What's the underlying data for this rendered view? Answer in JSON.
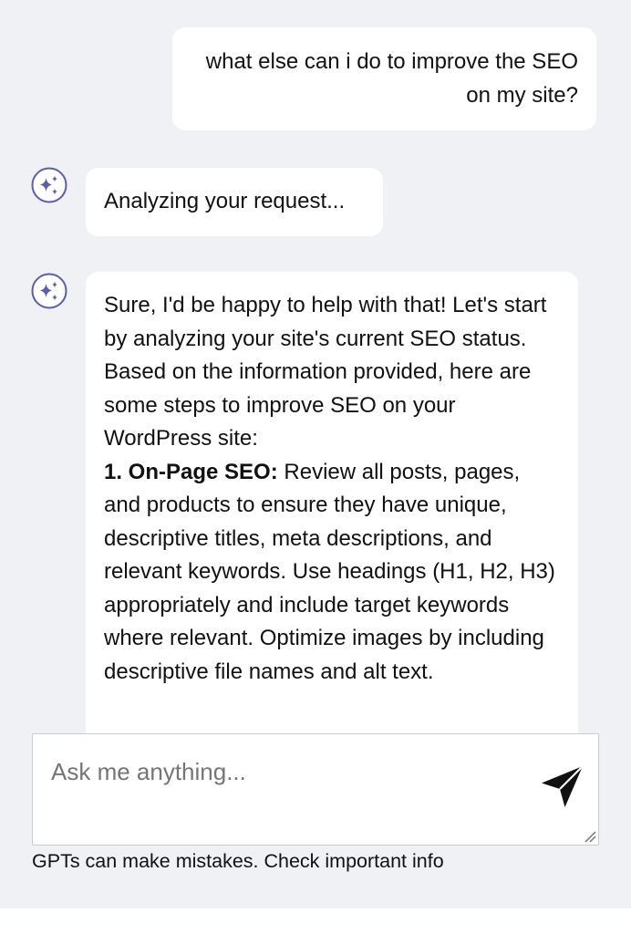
{
  "conversation": {
    "user_message": "what else can i do to improve the SEO on my site?",
    "status_message": "Analyzing your request...",
    "assistant_intro": "Sure, I'd be happy to help with that! Let's start by analyzing your site's current SEO status.",
    "assistant_lead": "Based on the information provided, here are some steps to improve SEO on your WordPress site:",
    "step_1_title": "1. On-Page SEO:",
    "step_1_body": "Review all posts, pages, and products to ensure they have unique, descriptive titles, meta descriptions, and relevant keywords. Use headings (H1, H2, H3) appropriately and include target keywords where relevant. Optimize images by including descriptive file names and alt text."
  },
  "composer": {
    "placeholder": "Ask me anything..."
  },
  "footer": {
    "disclaimer": "GPTs can make mistakes. Check important info"
  },
  "icons": {
    "assistant_avatar": "sparkles-icon",
    "send": "send-icon"
  },
  "colors": {
    "background": "#f0f1f5",
    "bubble": "#ffffff",
    "avatar_accent": "#5b5fa8",
    "send_icon": "#111111"
  }
}
